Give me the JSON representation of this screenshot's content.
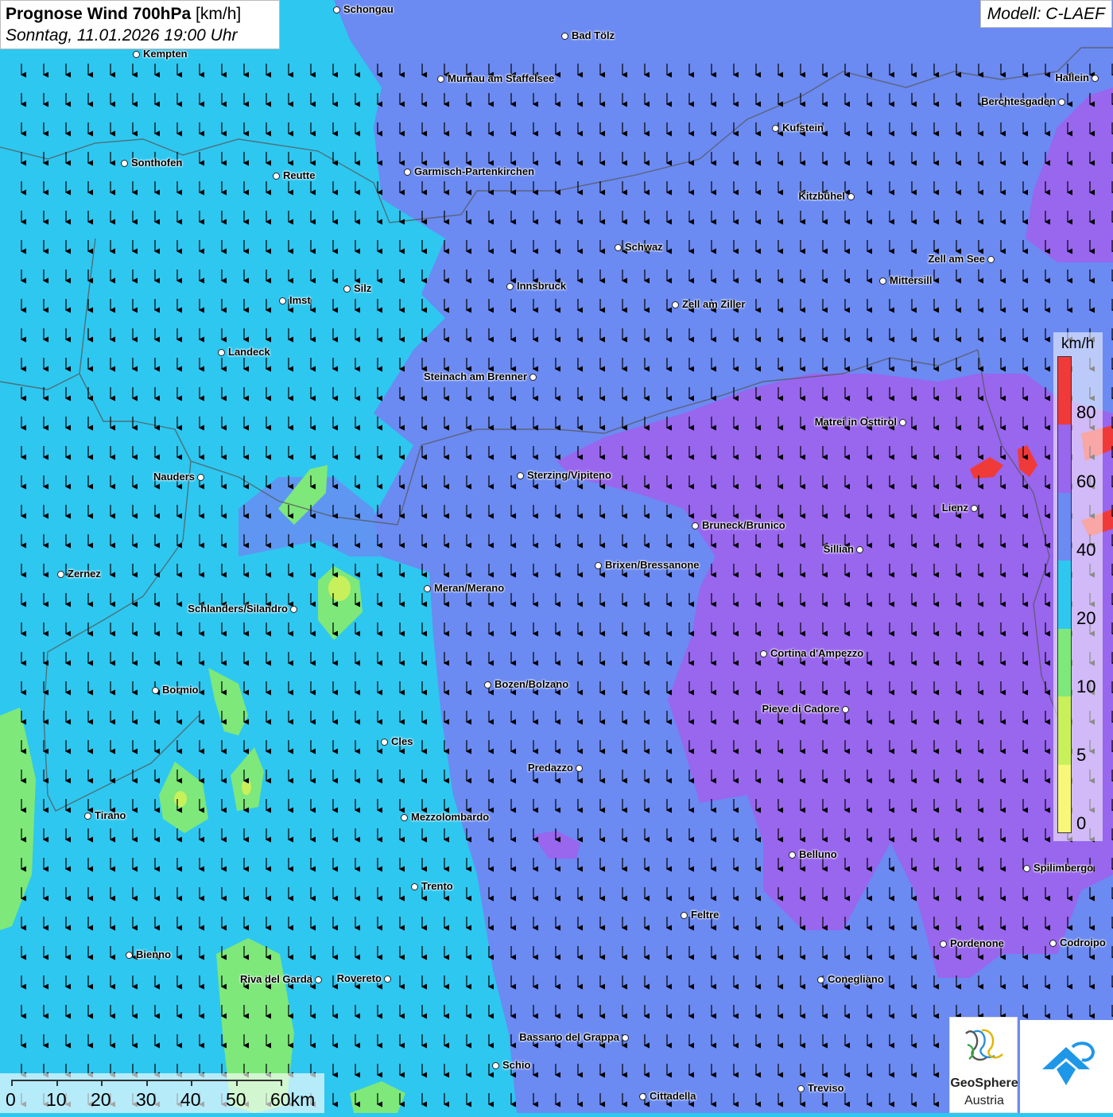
{
  "header": {
    "title_bold": "Prognose Wind 700hPa",
    "title_unit": "[km/h]",
    "datetime": "Sonntag, 11.01.2026 19:00 Uhr"
  },
  "model": "Modell: C-LAEF",
  "legend": {
    "unit": "km/h",
    "ticks": [
      "80",
      "60",
      "40",
      "20",
      "10",
      "5",
      "0"
    ],
    "colors": [
      "#f03a3a",
      "#9966ee",
      "#6b8af2",
      "#2ec7f0",
      "#7ee87a",
      "#c8f05a",
      "#f7f77a"
    ]
  },
  "scale": {
    "labels": [
      "0",
      "10",
      "20",
      "30",
      "40",
      "50",
      "60km"
    ]
  },
  "logo": {
    "name": "GeoSphere",
    "sub": "Austria"
  },
  "wind": {
    "direction": "north",
    "arrow_symbol": "↓"
  },
  "cities": [
    "Schongau",
    "Bad Tölz",
    "Kempten",
    "Murnau am Staffelsee",
    "Hallein",
    "Berchtesgaden",
    "Kufstein",
    "Sonthofen",
    "Reutte",
    "Garmisch-Partenkirchen",
    "Kitzbühel",
    "Schwaz",
    "Zell am See",
    "Innsbruck",
    "Mittersill",
    "Silz",
    "Imst",
    "Zell am Ziller",
    "Landeck",
    "Steinach am Brenner",
    "Matrei in Osttirol",
    "Nauders",
    "Sterzing/Vipiteno",
    "Lienz",
    "Bruneck/Brunico",
    "Sillian",
    "Zernez",
    "Brixen/Bressanone",
    "Meran/Merano",
    "Schlanders/Silandro",
    "Cortina d'Ampezzo",
    "Bozen/Bolzano",
    "Bormio",
    "Pieve di Cadore",
    "Cles",
    "Predazzo",
    "Tirano",
    "Mezzolombardo",
    "Belluno",
    "Spilimbergo",
    "Trento",
    "Feltre",
    "Bienno",
    "Pordenone",
    "Codroipo",
    "Riva del Garda",
    "Rovereto",
    "Conegliano",
    "Bassano del Grappa",
    "Schio",
    "Treviso",
    "Cittadella"
  ]
}
